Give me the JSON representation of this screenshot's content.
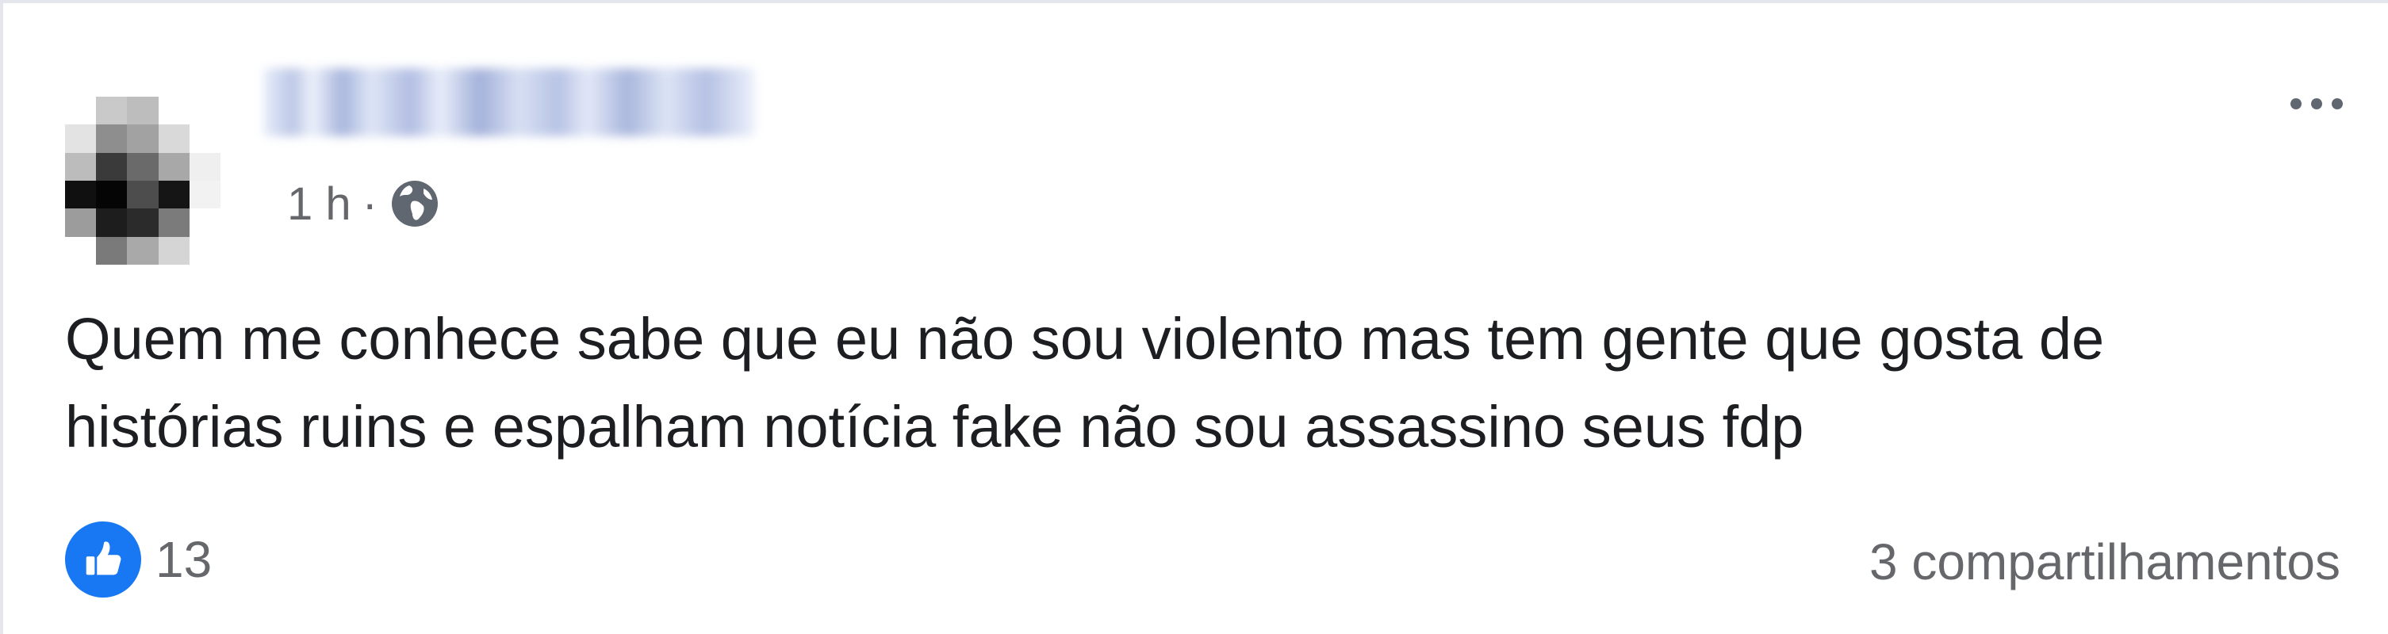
{
  "post": {
    "author_name": "",
    "timestamp": "1 h",
    "separator": "·",
    "audience_icon": "globe-icon",
    "more_icon": "more-horizontal-icon",
    "text_line_1": "Quem me conhece sabe que eu não sou violento mas tem gente que gosta de",
    "text_line_2": "histórias ruins e espalham notícia fake não sou assassino seus fdp",
    "reactions": {
      "icon": "like-icon",
      "count": "13"
    },
    "shares_text": "3 compartilhamentos"
  },
  "colors": {
    "text_primary": "#1c1e21",
    "text_secondary": "#65676b",
    "like_blue": "#1877f2",
    "border": "#e4e6eb"
  }
}
